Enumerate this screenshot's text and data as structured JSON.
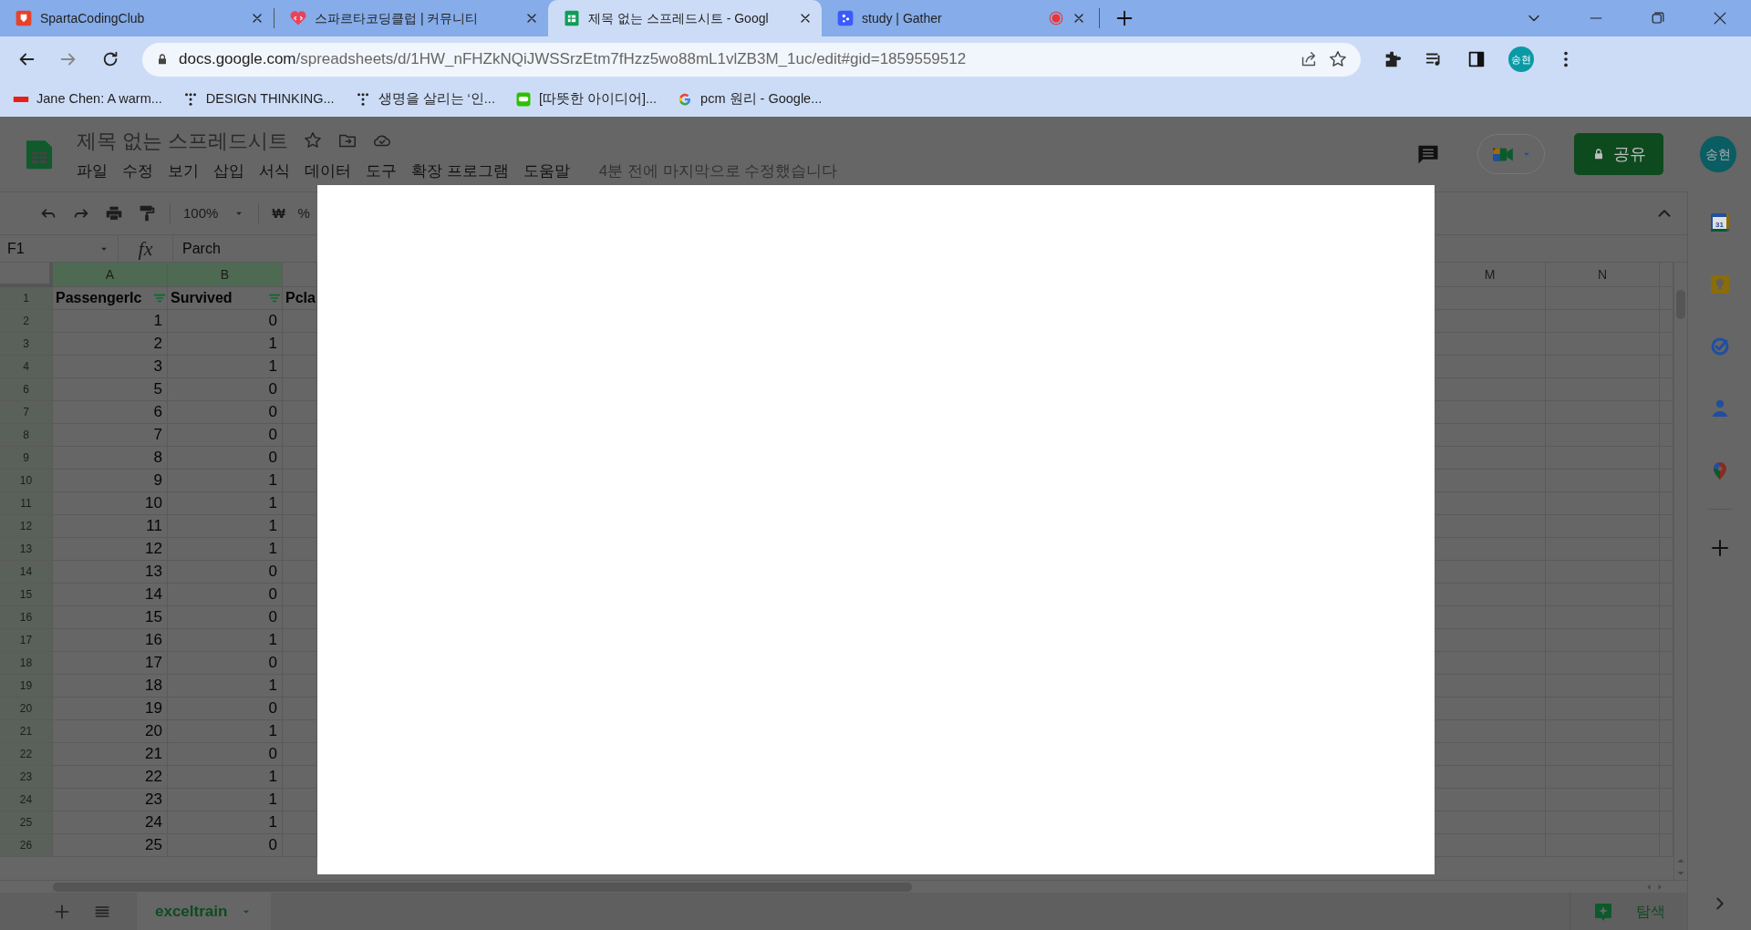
{
  "browser": {
    "tabs": [
      {
        "title": "SpartaCodingClub",
        "selected": false,
        "recording": false
      },
      {
        "title": "스파르타코딩클럽 | 커뮤니티",
        "selected": false,
        "recording": false
      },
      {
        "title": "제목 없는 스프레드시트 - Googl",
        "selected": true,
        "recording": false
      },
      {
        "title": "study | Gather",
        "selected": false,
        "recording": true
      }
    ],
    "address": {
      "host": "docs.google.com",
      "path": "/spreadsheets/d/1HW_nFHZkNQiJWSSrzEtm7fHzz5wo88mL1vlZB3M_1uc/edit#gid=1859559512"
    },
    "profile": "송현",
    "bookmarks": [
      {
        "label": "Jane Chen: A warm..."
      },
      {
        "label": "DESIGN THINKING..."
      },
      {
        "label": "생명을 살리는 ‘인..."
      },
      {
        "label": "[따뜻한 아이디어]..."
      },
      {
        "label": "pcm 원리 - Google..."
      }
    ]
  },
  "sheets": {
    "title": "제목 없는 스프레드시트",
    "menu": [
      "파일",
      "수정",
      "보기",
      "삽입",
      "서식",
      "데이터",
      "도구",
      "확장 프로그램",
      "도움말"
    ],
    "last_edit": "4분 전에 마지막으로 수정했습니다",
    "share": "공유",
    "avatar": "송현",
    "zoom": "100%",
    "currency_button": "₩",
    "percent_button": "%",
    "name_box": "F1",
    "fx": "fx",
    "formula": "Parch",
    "columns": [
      {
        "label": "A",
        "highlighted": true
      },
      {
        "label": "B",
        "highlighted": true
      },
      {
        "label": "M",
        "highlighted": false
      },
      {
        "label": "N",
        "highlighted": false
      }
    ],
    "header_row": {
      "number": "1",
      "cells": [
        {
          "text": "PassengerIc",
          "filter": true
        },
        {
          "text": "Survived",
          "filter": true
        },
        {
          "text": "Pcla",
          "filter": false
        }
      ]
    },
    "rows": [
      {
        "number": "2",
        "a": "1",
        "b": "0"
      },
      {
        "number": "3",
        "a": "2",
        "b": "1"
      },
      {
        "number": "4",
        "a": "3",
        "b": "1"
      },
      {
        "number": "6",
        "a": "5",
        "b": "0"
      },
      {
        "number": "7",
        "a": "6",
        "b": "0"
      },
      {
        "number": "8",
        "a": "7",
        "b": "0"
      },
      {
        "number": "9",
        "a": "8",
        "b": "0"
      },
      {
        "number": "10",
        "a": "9",
        "b": "1"
      },
      {
        "number": "11",
        "a": "10",
        "b": "1"
      },
      {
        "number": "12",
        "a": "11",
        "b": "1"
      },
      {
        "number": "13",
        "a": "12",
        "b": "1"
      },
      {
        "number": "14",
        "a": "13",
        "b": "0"
      },
      {
        "number": "15",
        "a": "14",
        "b": "0"
      },
      {
        "number": "16",
        "a": "15",
        "b": "0"
      },
      {
        "number": "17",
        "a": "16",
        "b": "1"
      },
      {
        "number": "18",
        "a": "17",
        "b": "0"
      },
      {
        "number": "19",
        "a": "18",
        "b": "1"
      },
      {
        "number": "20",
        "a": "19",
        "b": "0"
      },
      {
        "number": "21",
        "a": "20",
        "b": "1"
      },
      {
        "number": "22",
        "a": "21",
        "b": "0"
      },
      {
        "number": "23",
        "a": "22",
        "b": "1"
      },
      {
        "number": "24",
        "a": "23",
        "b": "1"
      },
      {
        "number": "25",
        "a": "24",
        "b": "1"
      },
      {
        "number": "26",
        "a": "25",
        "b": "0"
      }
    ],
    "sheet_tabs": [
      {
        "label": "exceltrain",
        "selected": true
      }
    ],
    "explore": "탐색",
    "calendar_day": "31"
  },
  "dialog": {
    "open": true
  }
}
